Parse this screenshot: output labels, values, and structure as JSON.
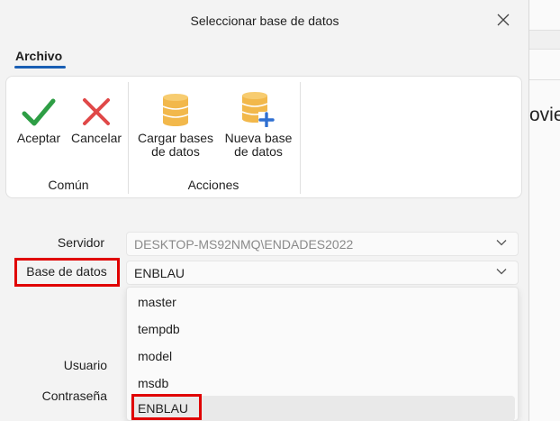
{
  "dialog": {
    "title": "Seleccionar base de datos"
  },
  "ribbon": {
    "tab_label": "Archivo",
    "buttons": {
      "accept": "Aceptar",
      "cancel": "Cancelar",
      "load_db_line1": "Cargar bases",
      "load_db_line2": "de datos",
      "new_db_line1": "Nueva base",
      "new_db_line2": "de datos"
    },
    "groups": {
      "common": "Común",
      "actions": "Acciones"
    }
  },
  "form": {
    "server_label": "Servidor",
    "server_value": "DESKTOP-MS92NMQ\\ENDADES2022",
    "database_label": "Base de datos",
    "database_value": "ENBLAU",
    "user_label": "Usuario",
    "password_label": "Contraseña"
  },
  "dropdown": {
    "options": [
      "master",
      "tempdb",
      "model",
      "msdb",
      "ENBLAU"
    ],
    "selected": "ENBLAU"
  },
  "background": {
    "partial_text": "ovie"
  },
  "colors": {
    "accent": "#1a5fb4",
    "highlight_box": "#e00000",
    "accept_check": "#2e9e45",
    "cancel_x": "#e04848",
    "db_icon": "#f2b84b",
    "plus_icon": "#2f6fd1"
  },
  "icons": {
    "close": "close-icon",
    "accept": "checkmark-icon",
    "cancel": "x-icon",
    "load_db": "database-icon",
    "new_db": "database-add-icon",
    "combo": "chevron-down-icon"
  }
}
